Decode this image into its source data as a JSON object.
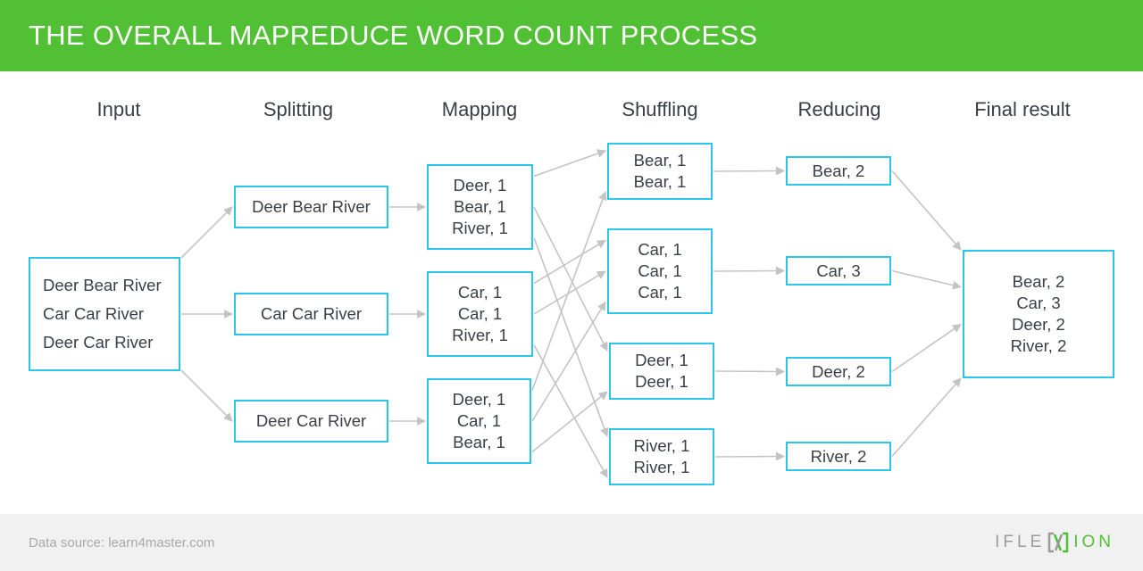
{
  "header": {
    "title": "THE OVERALL MAPREDUCE WORD COUNT PROCESS"
  },
  "stages": [
    "Input",
    "Splitting",
    "Mapping",
    "Shuffling",
    "Reducing",
    "Final result"
  ],
  "input": {
    "lines": [
      "Deer Bear River",
      "Car Car River",
      "Deer Car River"
    ]
  },
  "splitting": [
    {
      "lines": [
        "Deer Bear River"
      ]
    },
    {
      "lines": [
        "Car Car River"
      ]
    },
    {
      "lines": [
        "Deer Car River"
      ]
    }
  ],
  "mapping": [
    {
      "lines": [
        "Deer, 1",
        "Bear, 1",
        "River, 1"
      ]
    },
    {
      "lines": [
        "Car, 1",
        "Car, 1",
        "River, 1"
      ]
    },
    {
      "lines": [
        "Deer, 1",
        "Car, 1",
        "Bear, 1"
      ]
    }
  ],
  "shuffling": [
    {
      "lines": [
        "Bear, 1",
        "Bear, 1"
      ]
    },
    {
      "lines": [
        "Car, 1",
        "Car, 1",
        "Car, 1"
      ]
    },
    {
      "lines": [
        "Deer, 1",
        "Deer, 1"
      ]
    },
    {
      "lines": [
        "River, 1",
        "River, 1"
      ]
    }
  ],
  "reducing": [
    {
      "lines": [
        "Bear, 2"
      ]
    },
    {
      "lines": [
        "Car, 3"
      ]
    },
    {
      "lines": [
        "Deer, 2"
      ]
    },
    {
      "lines": [
        "River, 2"
      ]
    }
  ],
  "final_result": {
    "lines": [
      "Bear, 2",
      "Car, 3",
      "Deer, 2",
      "River, 2"
    ]
  },
  "edges": [
    [
      "input",
      "split-0"
    ],
    [
      "input",
      "split-1"
    ],
    [
      "input",
      "split-2"
    ],
    [
      "split-0",
      "map-0"
    ],
    [
      "split-1",
      "map-1"
    ],
    [
      "split-2",
      "map-2"
    ],
    [
      "map-0",
      "shuffle-0"
    ],
    [
      "map-0",
      "shuffle-2"
    ],
    [
      "map-0",
      "shuffle-3"
    ],
    [
      "map-1",
      "shuffle-1"
    ],
    [
      "map-1",
      "shuffle-1"
    ],
    [
      "map-1",
      "shuffle-3"
    ],
    [
      "map-2",
      "shuffle-0"
    ],
    [
      "map-2",
      "shuffle-1"
    ],
    [
      "map-2",
      "shuffle-2"
    ],
    [
      "shuffle-0",
      "reduce-0"
    ],
    [
      "shuffle-1",
      "reduce-1"
    ],
    [
      "shuffle-2",
      "reduce-2"
    ],
    [
      "shuffle-3",
      "reduce-3"
    ],
    [
      "reduce-0",
      "final"
    ],
    [
      "reduce-1",
      "final"
    ],
    [
      "reduce-2",
      "final"
    ],
    [
      "reduce-3",
      "final"
    ]
  ],
  "colors": {
    "header_green": "#52c035",
    "box_border": "#29c5ea",
    "arrow": "#c4c4c4"
  },
  "footer": {
    "source": "Data source: learn4master.com",
    "logo": {
      "left": "IFLE",
      "mark": "X",
      "right": "ION"
    }
  }
}
